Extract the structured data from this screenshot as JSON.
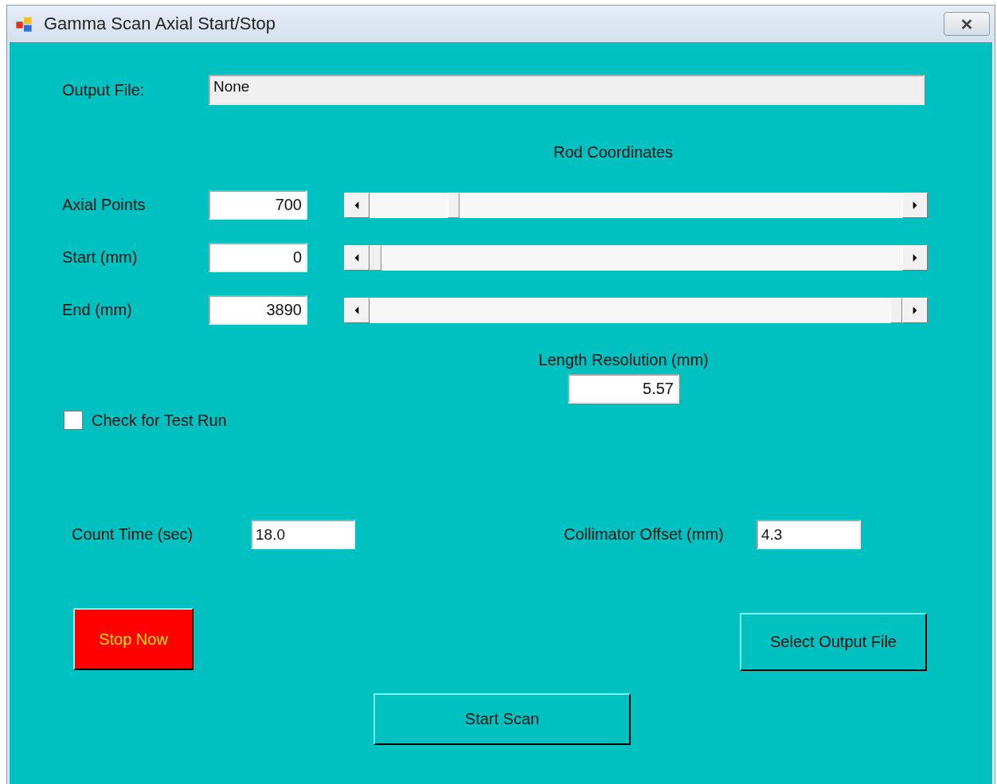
{
  "window": {
    "title": "Gamma Scan Axial Start/Stop"
  },
  "output_file": {
    "label": "Output File:",
    "value": "None"
  },
  "rod_coordinates": {
    "heading": "Rod Coordinates",
    "rows": [
      {
        "label": "Axial Points",
        "value": "700"
      },
      {
        "label": "Start (mm)",
        "value": "0"
      },
      {
        "label": "End (mm)",
        "value": "3890"
      }
    ]
  },
  "length_resolution": {
    "label": "Length Resolution (mm)",
    "value": "5.57"
  },
  "test_run": {
    "label": "Check for Test Run",
    "checked": false
  },
  "count_time": {
    "label": "Count Time (sec)",
    "value": "18.0"
  },
  "collimator_offset": {
    "label": "Collimator Offset (mm)",
    "value": "4.3"
  },
  "buttons": [
    {
      "label": "Stop Now",
      "kind": "stop"
    },
    {
      "label": "Select Output File",
      "kind": "select"
    },
    {
      "label": "Start Scan",
      "kind": "start"
    }
  ]
}
